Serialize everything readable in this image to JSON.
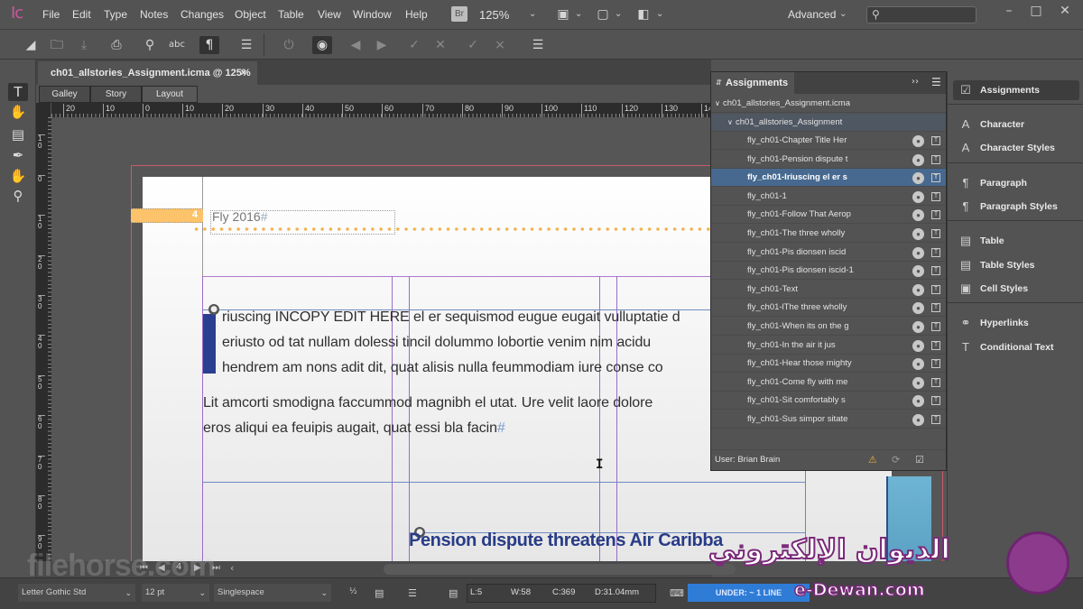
{
  "app": {
    "logo": "Ic",
    "menu": [
      "File",
      "Edit",
      "Type",
      "Notes",
      "Changes",
      "Object",
      "Table",
      "View",
      "Window",
      "Help"
    ],
    "bridge_badge": "Br",
    "zoom": "125%",
    "workspace": "Advanced",
    "search_placeholder": ""
  },
  "toolbar": {
    "icons": [
      "new-doc-icon",
      "open-folder-icon",
      "save-icon",
      "print-icon",
      "find-icon",
      "spellcheck-icon",
      "pilcrow-icon",
      "menu-icon",
      "track-changes-power-icon",
      "show-changes-eye-icon",
      "prev-change-icon",
      "next-change-icon",
      "accept-change-icon",
      "reject-change-icon",
      "accept-all-icon",
      "reject-all-icon",
      "menu-icon"
    ]
  },
  "document": {
    "tab_title": "ch01_allstories_Assignment.icma @ 125%",
    "close": "×",
    "view_tabs": [
      {
        "label": "Galley",
        "active": false
      },
      {
        "label": "Story",
        "active": false
      },
      {
        "label": "Layout",
        "active": true
      }
    ]
  },
  "ruler_h": [
    "20",
    "10",
    "0",
    "10",
    "20",
    "30",
    "40",
    "50",
    "60",
    "70",
    "80",
    "90",
    "100",
    "110",
    "120",
    "130",
    "14"
  ],
  "ruler_v": [
    "1 0",
    "0",
    "1 0",
    "2 0",
    "3 0",
    "4 0",
    "5 0",
    "6 0",
    "7 0",
    "8 0",
    "9 0"
  ],
  "page": {
    "folio_number": "4",
    "folio_text": "Fly 2016",
    "pilcrow": "#",
    "para1": [
      "riuscing INCOPY EDIT HERE el er sequismod eugue eugait vulluptatie d",
      "eriusto od tat nullam dolessi tincil dolummo lobortie venim nim acidu",
      "hendrem am nons adit dit, quat alisis nulla feummodiam iure conse co"
    ],
    "para2": [
      "Lit amcorti smodigna faccummod magnibh el utat. Ure velit laore dolore",
      "eros aliqui ea feuipis augait, quat essi bla facin"
    ],
    "headline": "Pension dispute threatens Air Caribba"
  },
  "canvas_nav": {
    "page": "4"
  },
  "assignments": {
    "title": "Assignments",
    "file": "ch01_allstories_Assignment.icma",
    "group": "ch01_allstories_Assignment",
    "items": [
      {
        "label": "fly_ch01-Chapter Title Her",
        "selected": false
      },
      {
        "label": "fly_ch01-Pension dispute t",
        "selected": false
      },
      {
        "label": "fly_ch01-Iriuscing el er s",
        "selected": true
      },
      {
        "label": "fly_ch01-1",
        "selected": false
      },
      {
        "label": "fly_ch01-Follow That Aerop",
        "selected": false
      },
      {
        "label": "fly_ch01-The three wholly",
        "selected": false
      },
      {
        "label": "fly_ch01-Pis dionsen iscid",
        "selected": false
      },
      {
        "label": "fly_ch01-Pis dionsen iscid-1",
        "selected": false
      },
      {
        "label": "fly_ch01-Text",
        "selected": false
      },
      {
        "label": "fly_ch01-lThe three wholly",
        "selected": false
      },
      {
        "label": "fly_ch01-When its on the g",
        "selected": false
      },
      {
        "label": "fly_ch01-In the air it jus",
        "selected": false
      },
      {
        "label": "fly_ch01-Hear those mighty",
        "selected": false
      },
      {
        "label": "fly_ch01-Come fly with me",
        "selected": false
      },
      {
        "label": "fly_ch01-Sit comfortably s",
        "selected": false
      },
      {
        "label": "fly_ch01-Sus simpor sitate",
        "selected": false
      }
    ],
    "user": "User: Brian Brain"
  },
  "dock": {
    "groups": [
      [
        {
          "label": "Assignments",
          "icon": "assignments-icon",
          "active": true
        }
      ],
      [
        {
          "label": "Character",
          "icon": "character-icon"
        },
        {
          "label": "Character Styles",
          "icon": "character-styles-icon"
        }
      ],
      [
        {
          "label": "Paragraph",
          "icon": "paragraph-icon"
        },
        {
          "label": "Paragraph Styles",
          "icon": "paragraph-styles-icon"
        }
      ],
      [
        {
          "label": "Table",
          "icon": "table-icon"
        },
        {
          "label": "Table Styles",
          "icon": "table-styles-icon"
        },
        {
          "label": "Cell Styles",
          "icon": "cell-styles-icon"
        }
      ],
      [
        {
          "label": "Hyperlinks",
          "icon": "hyperlinks-icon"
        },
        {
          "label": "Conditional Text",
          "icon": "conditional-text-icon"
        }
      ]
    ]
  },
  "statusbar": {
    "font": "Letter Gothic Std",
    "size": "12 pt",
    "spacing": "Singlespace",
    "lines": "L:5",
    "words": "W:58",
    "chars": "C:369",
    "depth": "D:31.04mm",
    "copyfit": "UNDER:  ~ 1 LINE"
  },
  "watermarks": {
    "filehorse": "filehorse.com",
    "dewan_ar": "الديوان الإلكتروني",
    "dewan_en": "e-Dewan.com"
  }
}
